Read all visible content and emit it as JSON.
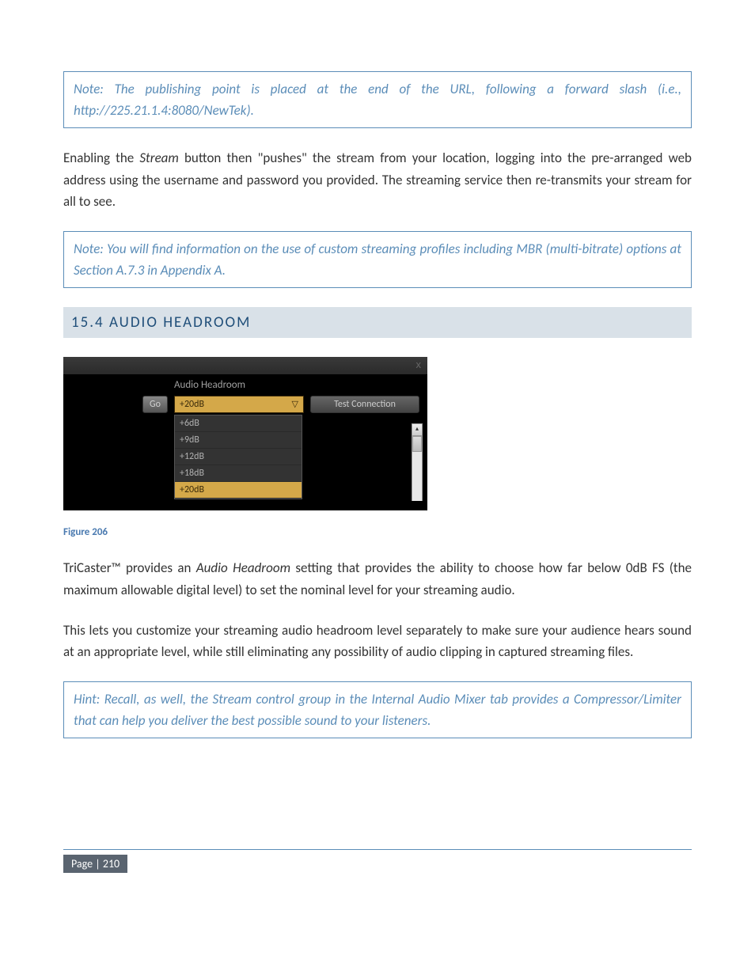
{
  "notes": {
    "note1": "Note: The publishing point is placed at the end of the URL, following a forward slash (i.e., http://225.21.1.4:8080/NewTek).",
    "note2": "Note: You will find information on the use of custom streaming profiles including MBR (multi-bitrate) options at Section A.7.3 in Appendix A.",
    "note3": "Hint: Recall, as well, the Stream control group in the Internal Audio Mixer tab provides a Compressor/Limiter that can help you deliver the best possible sound to your listeners."
  },
  "paragraphs": {
    "p1_a": "Enabling the ",
    "p1_term": "Stream",
    "p1_b": " button then \"pushes\" the stream from your location, logging into the pre-arranged web address using the username and password you provided.  The streaming service then re-transmits your stream for all to see.",
    "p2_a": "TriCaster™ provides an ",
    "p2_term": "Audio Headroom",
    "p2_b": " setting that provides the ability to choose how far below 0dB FS (the maximum allowable digital level) to set the nominal level for your streaming audio.",
    "p3": "This lets you customize your streaming audio headroom level separately to make sure your audience hears sound at an appropriate level, while still eliminating any possibility of audio clipping in captured streaming files."
  },
  "heading": "15.4  AUDIO HEADROOM",
  "panel": {
    "close": "x",
    "label": "Audio Headroom",
    "go": "Go",
    "selected": "+20dB",
    "arrow": "▽",
    "test": "Test Connection",
    "options": [
      "+6dB",
      "+9dB",
      "+12dB",
      "+18dB",
      "+20dB"
    ],
    "scroll_up": "▴"
  },
  "figure_caption": "Figure 206",
  "footer": "Page | 210"
}
